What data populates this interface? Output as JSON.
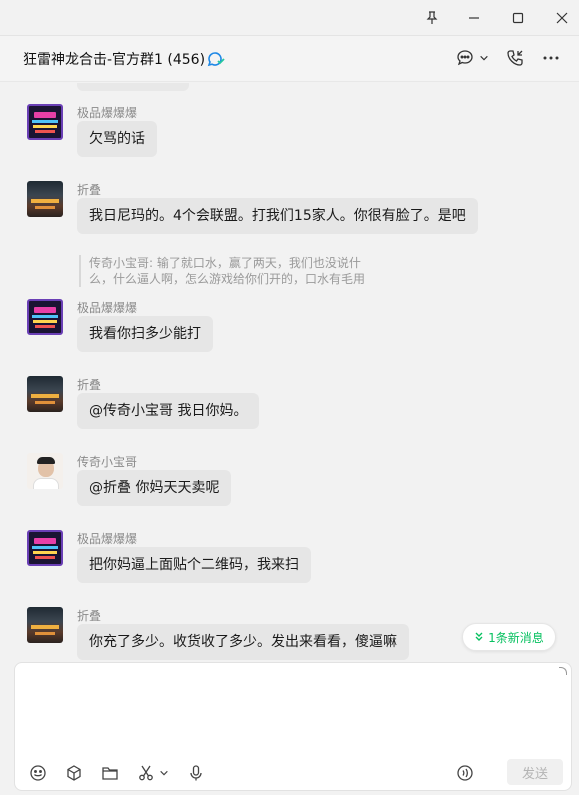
{
  "window": {
    "pin_icon": "pin-icon",
    "minimize_icon": "minimize-icon",
    "maximize_icon": "maximize-icon",
    "close_icon": "close-icon"
  },
  "header": {
    "title": "狂雷神龙合击-官方群1 (456)",
    "badge_icon": "group-badge-icon",
    "actions": [
      "chat-bubble-icon",
      "chevron-down-icon",
      "phone-icon",
      "more-icon"
    ]
  },
  "messages": [
    {
      "sender": "极品爆爆爆",
      "text": "欠骂的话",
      "avatar": "neon-sign"
    },
    {
      "sender": "折叠",
      "text": "我日尼玛的。4个会联盟。打我们15家人。你很有脸了。是吧",
      "avatar": "night-street",
      "quote": "传奇小宝哥: 输了就口水，赢了两天，我们也没说什么，什么逼人啊，怎么游戏给你们开的，口水有毛用"
    },
    {
      "sender": "极品爆爆爆",
      "text": "我看你扫多少能打",
      "avatar": "neon-sign"
    },
    {
      "sender": "折叠",
      "text": "@传奇小宝哥 我日你妈。",
      "avatar": "night-street"
    },
    {
      "sender": "传奇小宝哥",
      "text": "@折叠 你妈天天卖呢",
      "avatar": "portrait"
    },
    {
      "sender": "极品爆爆爆",
      "text": "把你妈逼上面贴个二维码，我来扫",
      "avatar": "neon-sign"
    },
    {
      "sender": "折叠",
      "text": "你充了多少。收货收了多少。发出来看看，傻逼嘛",
      "avatar": "night-street"
    }
  ],
  "new_message_pill": "1条新消息",
  "composer": {
    "value": "",
    "send_label": "发送",
    "tools": [
      "emoji-icon",
      "cube-icon",
      "folder-icon",
      "scissors-icon",
      "chevron-down-icon",
      "microphone-icon",
      "voice-input-icon"
    ]
  },
  "colors": {
    "accent": "#07c160",
    "bubble": "#e6e6e6",
    "background": "#f2f2f2"
  }
}
